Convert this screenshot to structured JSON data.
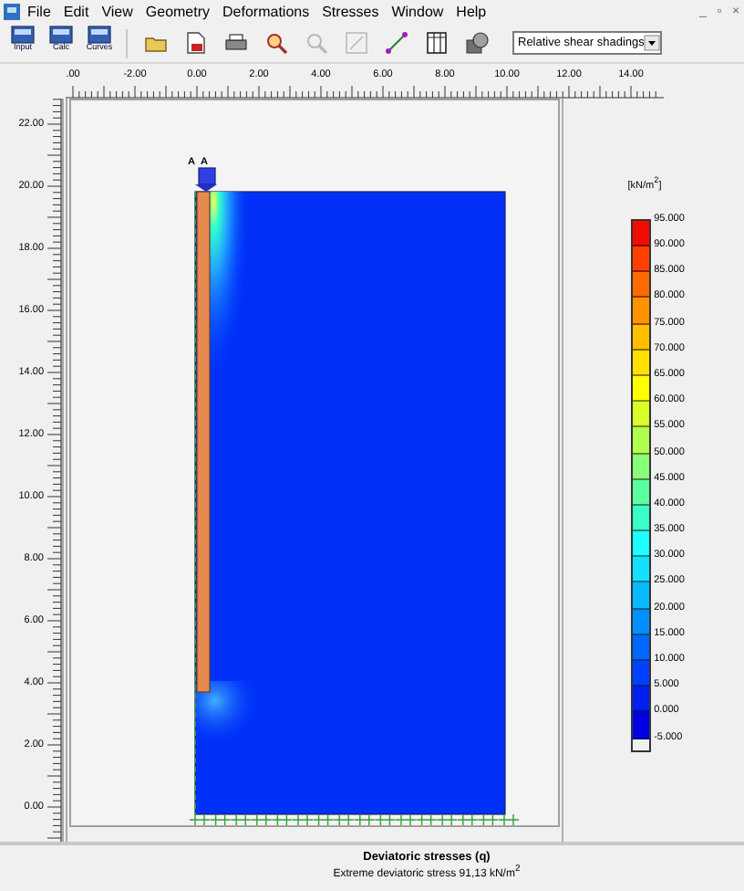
{
  "window": {
    "menu": [
      "File",
      "Edit",
      "View",
      "Geometry",
      "Deformations",
      "Stresses",
      "Window",
      "Help"
    ],
    "controls": [
      "_",
      "▫",
      "×"
    ]
  },
  "toolbar": {
    "modes": [
      "Input",
      "Calc",
      "Curves"
    ],
    "tools": [
      {
        "kind": "open",
        "disabled": false
      },
      {
        "kind": "report",
        "disabled": false
      },
      {
        "kind": "print",
        "disabled": false
      },
      {
        "kind": "zoom_in",
        "disabled": false
      },
      {
        "kind": "zoom_out",
        "disabled": true
      },
      {
        "kind": "resize",
        "disabled": true
      },
      {
        "kind": "cross_section",
        "disabled": false
      },
      {
        "kind": "table",
        "disabled": false
      },
      {
        "kind": "snapshot",
        "disabled": false
      }
    ],
    "view_select": {
      "value": "Relative shear shadings"
    }
  },
  "x_ruler": {
    "labels": [
      ".00",
      "-2.00",
      "0.00",
      "2.00",
      "4.00",
      "6.00",
      "8.00",
      "10.00",
      "12.00",
      "14.00"
    ]
  },
  "y_ruler": {
    "labels": [
      "22.00",
      "20.00",
      "18.00",
      "16.00",
      "14.00",
      "12.00",
      "10.00",
      "8.00",
      "6.00",
      "4.00",
      "2.00",
      "0.00"
    ]
  },
  "plot": {
    "point_labels": [
      "A",
      "A"
    ]
  },
  "legend": {
    "unit": "[kN/m$^{2}$]",
    "labels": [
      "95.000",
      "90.000",
      "85.000",
      "80.000",
      "75.000",
      "70.000",
      "65.000",
      "60.000",
      "55.000",
      "50.000",
      "45.000",
      "40.000",
      "35.000",
      "30.000",
      "25.000",
      "20.000",
      "15.000",
      "10.000",
      "5.000",
      "0.000",
      "-5.000"
    ],
    "bands": [
      {
        "color": "#f20c00"
      },
      {
        "color": "#ff4000"
      },
      {
        "color": "#ff6a00"
      },
      {
        "color": "#ff9400"
      },
      {
        "color": "#ffbe00"
      },
      {
        "color": "#ffe000"
      },
      {
        "color": "#ffff00"
      },
      {
        "color": "#d8ff28"
      },
      {
        "color": "#b0ff50"
      },
      {
        "color": "#88ff78"
      },
      {
        "color": "#5cffa0"
      },
      {
        "color": "#38ffc8"
      },
      {
        "color": "#1effff"
      },
      {
        "color": "#14e0ff"
      },
      {
        "color": "#0ab8ff"
      },
      {
        "color": "#0090ff"
      },
      {
        "color": "#0068ff"
      },
      {
        "color": "#0040ff"
      },
      {
        "color": "#0020f0"
      },
      {
        "color": "#0000e0"
      }
    ]
  },
  "caption": {
    "title": "Deviatoric stresses (q)",
    "subtitle": "Extreme deviatoric stress 91,13 kN/m$^{2}$"
  }
}
